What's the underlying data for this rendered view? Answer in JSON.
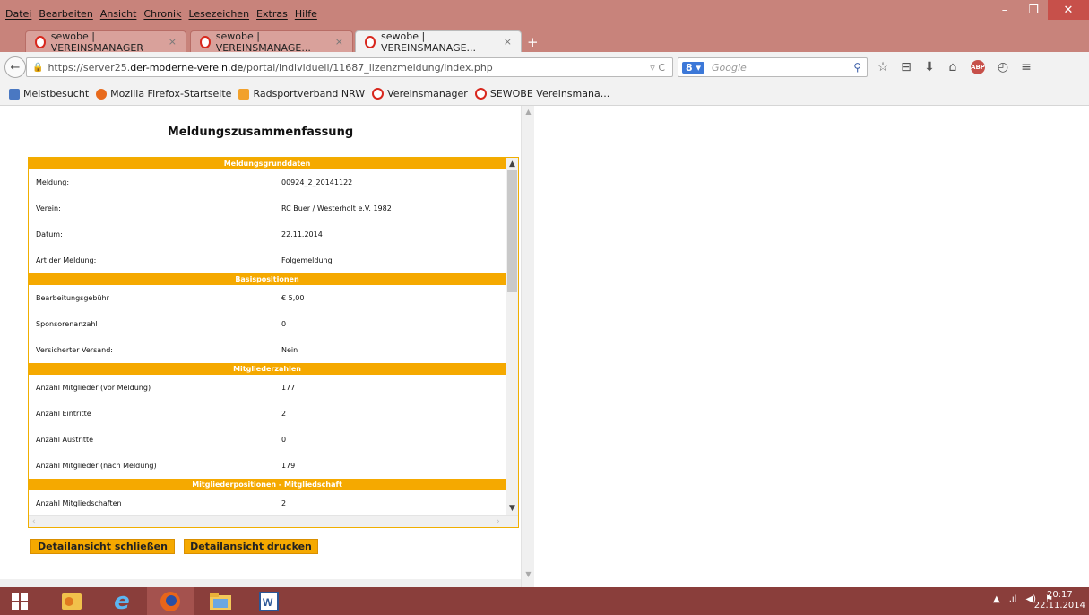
{
  "menu": [
    "Datei",
    "Bearbeiten",
    "Ansicht",
    "Chronik",
    "Lesezeichen",
    "Extras",
    "Hilfe"
  ],
  "window_controls": {
    "minimize": "–",
    "restore": "❐",
    "close": "✕"
  },
  "tabs": [
    {
      "title": "sewobe | VEREINSMANAGER",
      "close": "×"
    },
    {
      "title": "sewobe | VEREINSMANAGE...",
      "close": "×"
    },
    {
      "title": "sewobe | VEREINSMANAGE...",
      "close": "×"
    }
  ],
  "new_tab": "+",
  "nav": {
    "back": "←",
    "url_prefix": "https://server25.",
    "url_host": "der-moderne-verein.de",
    "url_path": "/portal/individuell/11687_lizenzmeldung/index.php",
    "url_right": "▿ C",
    "search_engine": "8 ▾",
    "search_placeholder": "Google",
    "search_icon": "⚲"
  },
  "bookmarks": [
    {
      "label": "Meistbesucht",
      "icon": "blue"
    },
    {
      "label": "Mozilla Firefox-Startseite",
      "icon": "ff"
    },
    {
      "label": "Radsportverband NRW",
      "icon": "rss"
    },
    {
      "label": "Vereinsmanager",
      "icon": "ring"
    },
    {
      "label": "SEWOBE Vereinsmana...",
      "icon": "ring"
    }
  ],
  "page": {
    "title": "Meldungszusammenfassung",
    "sections": [
      {
        "header": "Meldungsgrunddaten",
        "rows": [
          {
            "label": "Meldung:",
            "value": "00924_2_20141122"
          },
          {
            "label": "Verein:",
            "value": "RC Buer / Westerholt e.V. 1982"
          },
          {
            "label": "Datum:",
            "value": "22.11.2014"
          },
          {
            "label": "Art der Meldung:",
            "value": "Folgemeldung"
          }
        ]
      },
      {
        "header": "Basispositionen",
        "rows": [
          {
            "label": "Bearbeitungsgebühr",
            "value": "€ 5,00"
          },
          {
            "label": "Sponsorenanzahl",
            "value": "0"
          },
          {
            "label": "Versicherter Versand:",
            "value": "Nein"
          }
        ]
      },
      {
        "header": "Mitgliederzahlen",
        "rows": [
          {
            "label": "Anzahl Mitglieder (vor Meldung)",
            "value": "177"
          },
          {
            "label": "Anzahl Eintritte",
            "value": "2"
          },
          {
            "label": "Anzahl Austritte",
            "value": "0"
          },
          {
            "label": "Anzahl Mitglieder (nach Meldung)",
            "value": "179"
          }
        ]
      },
      {
        "header": "Mitgliederpositionen - Mitgliedschaft",
        "rows": [
          {
            "label": "Anzahl Mitgliedschaften",
            "value": "2"
          }
        ]
      }
    ],
    "buttons": {
      "close": "Detailansicht schließen",
      "print": "Detailansicht drucken"
    }
  },
  "taskbar": {
    "clock_time": "20:17",
    "clock_date": "22.11.2014"
  },
  "colors": {
    "accent": "#f5a900",
    "titlebar": "#c8837b",
    "taskbar": "#8a3e3b"
  }
}
